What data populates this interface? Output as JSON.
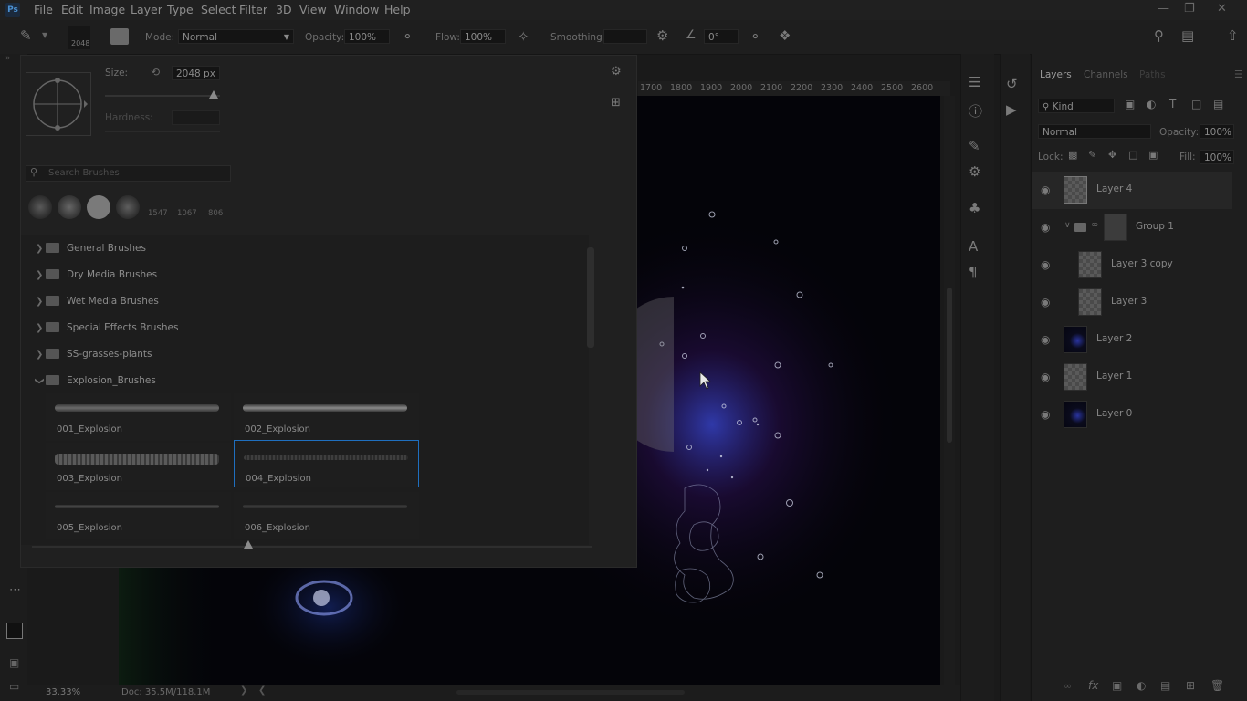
{
  "app": {
    "logo": "Ps"
  },
  "menu": [
    "File",
    "Edit",
    "Image",
    "Layer",
    "Type",
    "Select",
    "Filter",
    "3D",
    "View",
    "Window",
    "Help"
  ],
  "options": {
    "brush_size_label": "2048",
    "mode_label": "Mode:",
    "mode_value": "Normal",
    "opacity_label": "Opacity:",
    "opacity_value": "100%",
    "flow_label": "Flow:",
    "flow_value": "100%",
    "smoothing_label": "Smoothing:",
    "angle_value": "0°"
  },
  "brush_panel": {
    "size_label": "Size:",
    "size_value": "2048 px",
    "hardness_label": "Hardness:",
    "search_placeholder": "Search Brushes",
    "recent": [
      "1547",
      "1067",
      "806"
    ],
    "folders": [
      "General Brushes",
      "Dry Media Brushes",
      "Wet Media Brushes",
      "Special Effects Brushes",
      "SS-grasses-plants",
      "Explosion_Brushes"
    ],
    "brushes": [
      "001_Explosion",
      "002_Explosion",
      "003_Explosion",
      "004_Explosion",
      "005_Explosion",
      "006_Explosion"
    ]
  },
  "ruler": [
    "1700",
    "1800",
    "1900",
    "2000",
    "2100",
    "2200",
    "2300",
    "2400",
    "2500",
    "2600"
  ],
  "layers_panel": {
    "tabs": [
      "Layers",
      "Channels",
      "Paths"
    ],
    "filter_kind": "Kind",
    "blend_mode": "Normal",
    "opacity_label": "Opacity:",
    "opacity_value": "100%",
    "lock_label": "Lock:",
    "fill_label": "Fill:",
    "fill_value": "100%",
    "layers": [
      "Layer 4",
      "Group 1",
      "Layer 3 copy",
      "Layer 3",
      "Layer 2",
      "Layer 1",
      "Layer 0"
    ]
  },
  "status": {
    "zoom": "33.33%",
    "doc": "Doc: 35.5M/118.1M"
  },
  "colors": {
    "accent": "#1f6fbf",
    "canvas": "#040409",
    "panel": "#202020"
  },
  "icons": [
    "brush-icon",
    "brush-settings-icon",
    "airbrush-icon",
    "gear-icon",
    "angle-icon",
    "pressure-icon",
    "symmetry-icon",
    "search-icon",
    "workspace-icon",
    "share-icon",
    "eye-icon",
    "folder-icon",
    "chevron-right-icon",
    "close-icon",
    "minimize-icon",
    "maximize-icon"
  ]
}
